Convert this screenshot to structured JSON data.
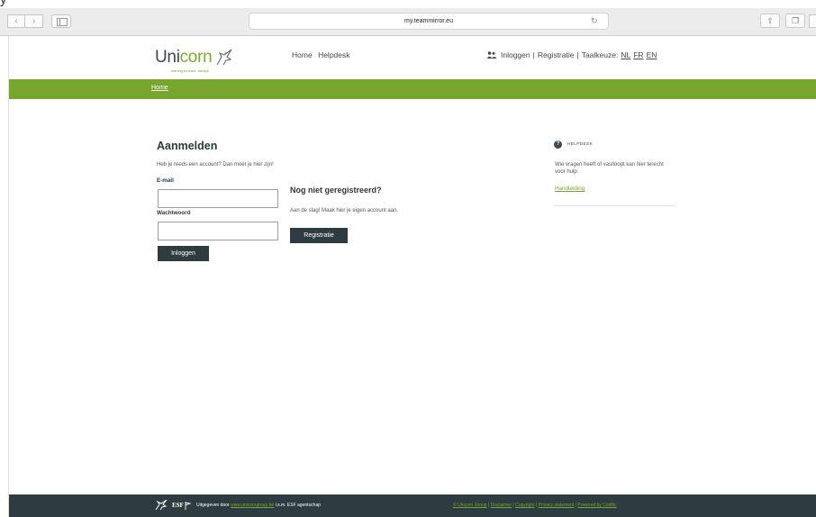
{
  "caption_fragment": "y",
  "browser": {
    "back_glyph": "‹",
    "forward_glyph": "›",
    "url": "my.teammirror.eu",
    "reload_glyph": "↻",
    "share_glyph": "⇧",
    "tabs_glyph": "❐"
  },
  "header": {
    "logo_text_a": "Uni",
    "logo_text_b": "corn",
    "logo_tagline": "leaning forward, always",
    "nav": [
      "Home",
      "Helpdesk"
    ],
    "utility": {
      "login": "Inloggen",
      "register": "Registratie",
      "sep": "|",
      "lang_label": "Taalkeuze:",
      "langs": [
        "NL",
        "FR",
        "EN"
      ]
    }
  },
  "breadcrumb": {
    "home": "Home"
  },
  "login": {
    "title": "Aanmelden",
    "subtitle": "Heb je reeds een account? Dan moet je hier zijn!",
    "email_label": "E-mail",
    "email_value": "",
    "password_label": "Wachtwoord",
    "password_value": "",
    "submit_label": "Inloggen"
  },
  "register": {
    "title": "Nog niet geregistreerd?",
    "text": "Aan de slag! Maak hier je eigen account aan.",
    "button_label": "Registratie"
  },
  "helpdesk": {
    "icon_glyph": "?",
    "title": "Helpdesk",
    "text": "Wie vragen heeft of vastloopt kan hier terecht voor hulp.",
    "link": "Handleiding"
  },
  "footer": {
    "esf": "ESF",
    "published_prefix": "Uitgegeven door ",
    "published_link": "www.unicorngroup.be",
    "published_suffix": " i.s.m. ESF agentschap",
    "links": [
      "© Unicorn Group",
      "Disclaimer",
      "Copyright",
      "Privacy statement",
      "Powered by Codific"
    ],
    "sep": " | "
  },
  "colors": {
    "accent_green": "#77a52d",
    "dark": "#2e3b41"
  }
}
